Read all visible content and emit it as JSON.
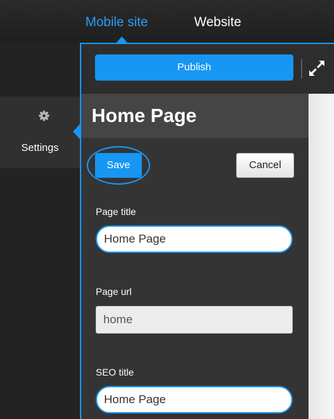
{
  "tabs": {
    "mobile_site": "Mobile site",
    "website": "Website"
  },
  "toolbar": {
    "publish_label": "Publish"
  },
  "sidebar": {
    "settings_label": "Settings"
  },
  "editor": {
    "heading": "Home Page",
    "save_label": "Save",
    "cancel_label": "Cancel",
    "fields": {
      "page_title": {
        "label": "Page title",
        "value": "Home Page"
      },
      "page_url": {
        "label": "Page url",
        "value": "home"
      },
      "seo_title": {
        "label": "SEO title",
        "value": "Home Page"
      }
    }
  },
  "colors": {
    "accent": "#1796f3",
    "active_tab": "#2d9ef5",
    "topbar": "#1f1f1f",
    "panel": "#343434"
  },
  "icons": [
    "gear-icon",
    "expand-icon"
  ]
}
